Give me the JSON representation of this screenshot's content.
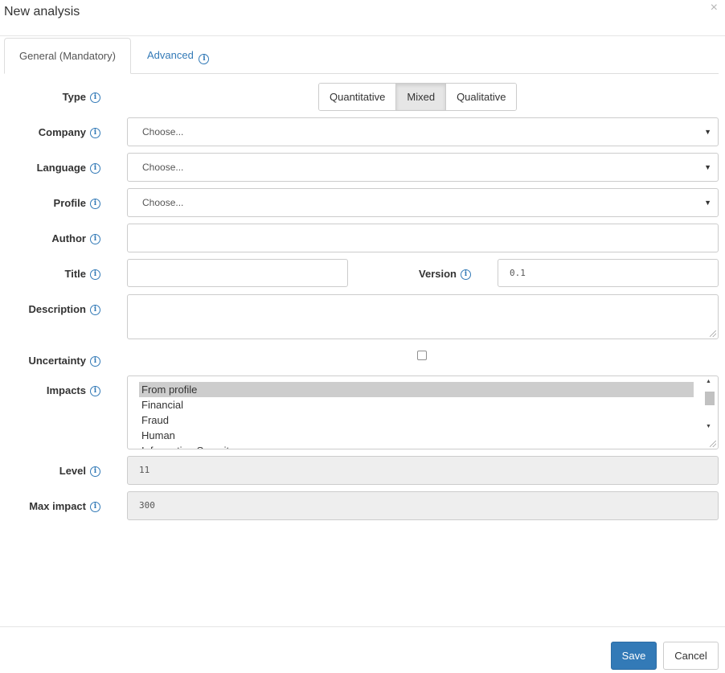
{
  "modal": {
    "title": "New analysis",
    "close_glyph": "×"
  },
  "tabs": [
    {
      "label": "General (Mandatory)",
      "active": true
    },
    {
      "label": "Advanced",
      "active": false
    }
  ],
  "form": {
    "type": {
      "label": "Type",
      "options": [
        "Quantitative",
        "Mixed",
        "Qualitative"
      ],
      "selected": "Mixed"
    },
    "company": {
      "label": "Company",
      "value": "Choose..."
    },
    "language": {
      "label": "Language",
      "value": "Choose..."
    },
    "profile": {
      "label": "Profile",
      "value": "Choose..."
    },
    "author": {
      "label": "Author",
      "value": ""
    },
    "title": {
      "label": "Title",
      "value": ""
    },
    "version": {
      "label": "Version",
      "value": "0.1"
    },
    "description": {
      "label": "Description",
      "value": ""
    },
    "uncertainty": {
      "label": "Uncertainty",
      "checked": false
    },
    "impacts": {
      "label": "Impacts",
      "items": [
        "From profile",
        "Financial",
        "Fraud",
        "Human",
        "Information Security"
      ],
      "selected": "From profile"
    },
    "level": {
      "label": "Level",
      "value": "11"
    },
    "max_impact": {
      "label": "Max impact",
      "value": "300"
    }
  },
  "icons": {
    "info": "info-icon",
    "dropdown": "caret-down-icon",
    "close": "close-icon"
  },
  "footer": {
    "save_label": "Save",
    "cancel_label": "Cancel"
  },
  "colors": {
    "accent": "#337ab7",
    "readonly_bg": "#eeeeee",
    "selected_item_bg": "#cdcdcd"
  }
}
